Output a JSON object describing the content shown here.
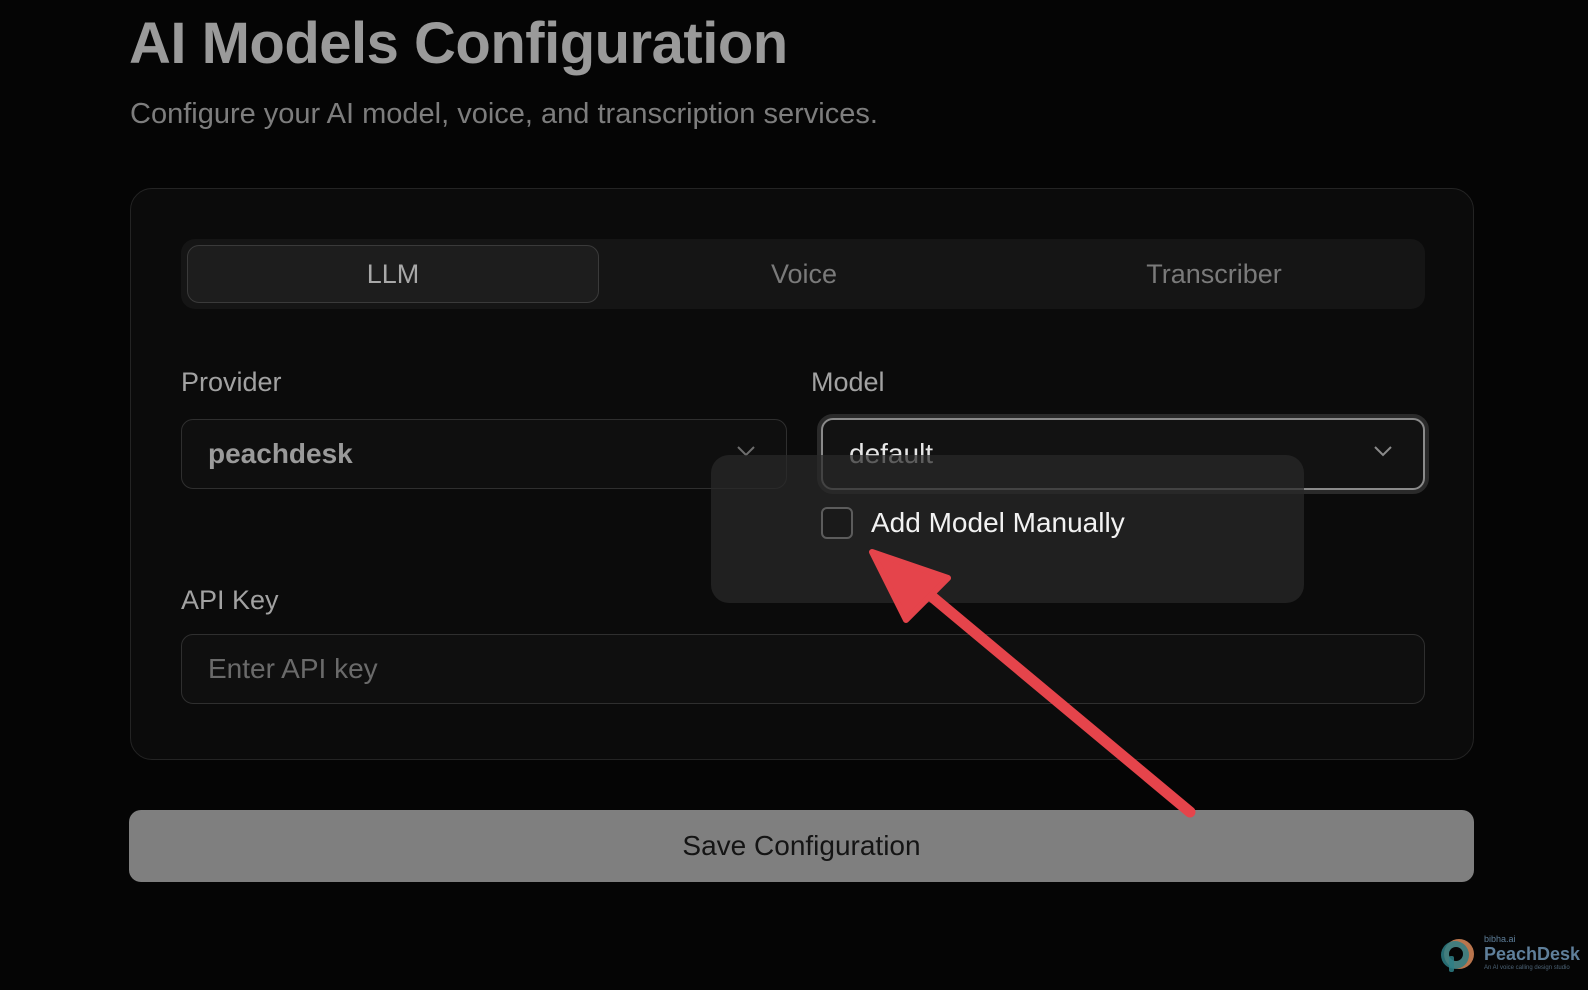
{
  "header": {
    "title": "AI Models Configuration",
    "subtitle": "Configure your AI model, voice, and transcription services."
  },
  "tabs": [
    {
      "label": "LLM",
      "active": true
    },
    {
      "label": "Voice",
      "active": false
    },
    {
      "label": "Transcriber",
      "active": false
    }
  ],
  "form": {
    "provider": {
      "label": "Provider",
      "value": "peachdesk"
    },
    "model": {
      "label": "Model",
      "value": "default"
    },
    "manual_checkbox": {
      "label": "Add Model Manually",
      "checked": false
    },
    "api_key": {
      "label": "API Key",
      "placeholder": "Enter API key",
      "value": ""
    }
  },
  "actions": {
    "save_label": "Save Configuration"
  },
  "annotation": {
    "arrow_color": "#e5444b",
    "icon": "arrow-annotation-icon"
  },
  "brand": {
    "small": "bibha.ai",
    "name": "PeachDesk",
    "tagline": "An AI voice calling design studio",
    "colors": {
      "logo_orange": "#d98a5a",
      "logo_teal": "#2e7f86",
      "text": "#5f7f9a"
    }
  },
  "colors": {
    "background": "#050505",
    "card": "#0b0b0b",
    "save_button": "#7f7f7f"
  }
}
